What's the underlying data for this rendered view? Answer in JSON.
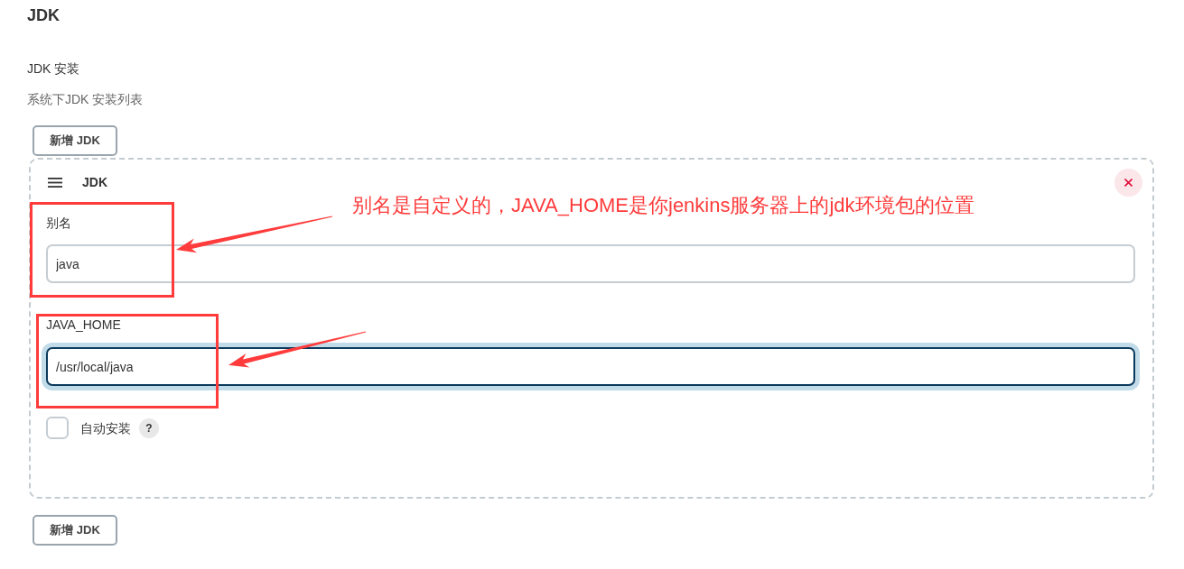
{
  "section": {
    "title": "JDK"
  },
  "installations": {
    "label": "JDK 安装",
    "description": "系统下JDK 安装列表"
  },
  "add_button_top": {
    "label": "新增 JDK"
  },
  "jdk_card": {
    "title": "JDK",
    "fields": [
      {
        "label": "别名",
        "value": "java",
        "focused": false
      },
      {
        "label": "JAVA_HOME",
        "value": "/usr/local/java",
        "focused": true
      }
    ],
    "auto_install": {
      "label": "自动安装",
      "checked": false,
      "help": "?"
    }
  },
  "add_button_bottom": {
    "label": "新增 JDK"
  },
  "annotation": {
    "note": "别名是自定义的，JAVA_HOME是你jenkins服务器上的jdk环境包的位置"
  }
}
